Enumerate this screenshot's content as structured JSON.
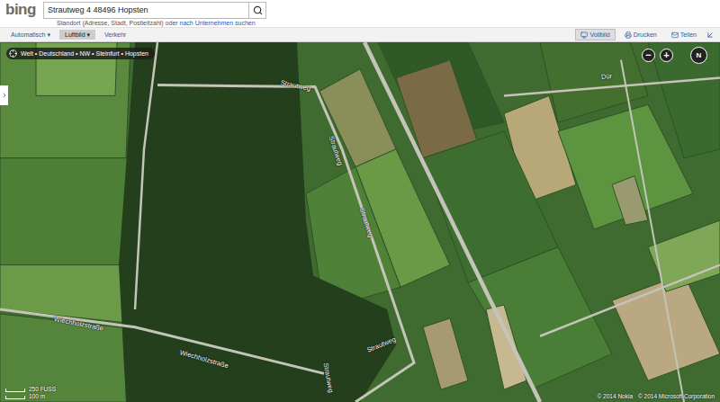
{
  "logo": "bing",
  "search": {
    "value": "Strautweg 4 48496 Hopsten"
  },
  "hint": {
    "text": "Standort (Adresse, Stadt, Postleitzahl) oder ",
    "link": "nach Unternehmen suchen"
  },
  "caret": "▾",
  "view_tabs": [
    {
      "label": "Automatisch",
      "dropdown": true,
      "selected": false
    },
    {
      "label": "Luftbild",
      "dropdown": true,
      "selected": true
    },
    {
      "label": "Verkehr",
      "dropdown": false,
      "selected": false
    }
  ],
  "actions": [
    {
      "label": "Vollbild",
      "selected": true
    },
    {
      "label": "Drucken",
      "selected": false
    },
    {
      "label": "Teilen",
      "selected": false
    }
  ],
  "breadcrumb": "Welt • Deutschland • NW • Steinfurt • Hopsten",
  "zoom": {
    "out": "−",
    "in": "+"
  },
  "compass": "N",
  "road_labels": [
    "Strautweg",
    "Strautweg",
    "Strautweg",
    "Strautweg",
    "Strautweg",
    "Wiechholzstraße",
    "Wiechholzstraße",
    "Dür"
  ],
  "scale": {
    "imperial": "250 FUSS",
    "metric": "100 m"
  },
  "copyright": [
    "© 2014 Nokia",
    "© 2014 Microsoft Corporation"
  ]
}
